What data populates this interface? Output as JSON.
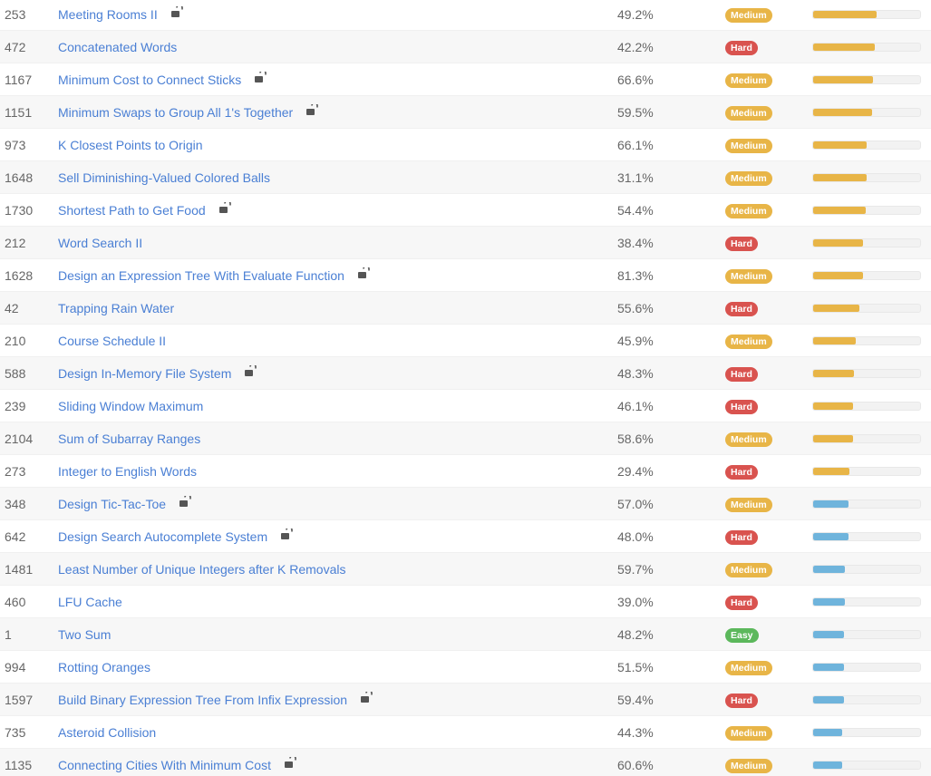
{
  "colors": {
    "medium": "#e8b547",
    "hard": "#d9534f",
    "easy": "#5cb85c",
    "freq_high": "#e8b547",
    "freq_low": "#6fb4dc",
    "link": "#4a7fd4"
  },
  "problems": [
    {
      "id": "253",
      "title": "Meeting Rooms II",
      "locked": true,
      "acceptance": "49.2%",
      "difficulty": "Medium",
      "frequency": 0.59,
      "freq_level": "high"
    },
    {
      "id": "472",
      "title": "Concatenated Words",
      "locked": false,
      "acceptance": "42.2%",
      "difficulty": "Hard",
      "frequency": 0.58,
      "freq_level": "high"
    },
    {
      "id": "1167",
      "title": "Minimum Cost to Connect Sticks",
      "locked": true,
      "acceptance": "66.6%",
      "difficulty": "Medium",
      "frequency": 0.56,
      "freq_level": "high"
    },
    {
      "id": "1151",
      "title": "Minimum Swaps to Group All 1's Together",
      "locked": true,
      "acceptance": "59.5%",
      "difficulty": "Medium",
      "frequency": 0.55,
      "freq_level": "high"
    },
    {
      "id": "973",
      "title": "K Closest Points to Origin",
      "locked": false,
      "acceptance": "66.1%",
      "difficulty": "Medium",
      "frequency": 0.5,
      "freq_level": "high"
    },
    {
      "id": "1648",
      "title": "Sell Diminishing-Valued Colored Balls",
      "locked": false,
      "acceptance": "31.1%",
      "difficulty": "Medium",
      "frequency": 0.5,
      "freq_level": "high"
    },
    {
      "id": "1730",
      "title": "Shortest Path to Get Food",
      "locked": true,
      "acceptance": "54.4%",
      "difficulty": "Medium",
      "frequency": 0.49,
      "freq_level": "high"
    },
    {
      "id": "212",
      "title": "Word Search II",
      "locked": false,
      "acceptance": "38.4%",
      "difficulty": "Hard",
      "frequency": 0.47,
      "freq_level": "high"
    },
    {
      "id": "1628",
      "title": "Design an Expression Tree With Evaluate Function",
      "locked": true,
      "acceptance": "81.3%",
      "difficulty": "Medium",
      "frequency": 0.47,
      "freq_level": "high"
    },
    {
      "id": "42",
      "title": "Trapping Rain Water",
      "locked": false,
      "acceptance": "55.6%",
      "difficulty": "Hard",
      "frequency": 0.43,
      "freq_level": "high"
    },
    {
      "id": "210",
      "title": "Course Schedule II",
      "locked": false,
      "acceptance": "45.9%",
      "difficulty": "Medium",
      "frequency": 0.4,
      "freq_level": "high"
    },
    {
      "id": "588",
      "title": "Design In-Memory File System",
      "locked": true,
      "acceptance": "48.3%",
      "difficulty": "Hard",
      "frequency": 0.38,
      "freq_level": "high"
    },
    {
      "id": "239",
      "title": "Sliding Window Maximum",
      "locked": false,
      "acceptance": "46.1%",
      "difficulty": "Hard",
      "frequency": 0.37,
      "freq_level": "high"
    },
    {
      "id": "2104",
      "title": "Sum of Subarray Ranges",
      "locked": false,
      "acceptance": "58.6%",
      "difficulty": "Medium",
      "frequency": 0.37,
      "freq_level": "high"
    },
    {
      "id": "273",
      "title": "Integer to English Words",
      "locked": false,
      "acceptance": "29.4%",
      "difficulty": "Hard",
      "frequency": 0.34,
      "freq_level": "high"
    },
    {
      "id": "348",
      "title": "Design Tic-Tac-Toe",
      "locked": true,
      "acceptance": "57.0%",
      "difficulty": "Medium",
      "frequency": 0.33,
      "freq_level": "low"
    },
    {
      "id": "642",
      "title": "Design Search Autocomplete System",
      "locked": true,
      "acceptance": "48.0%",
      "difficulty": "Hard",
      "frequency": 0.33,
      "freq_level": "low"
    },
    {
      "id": "1481",
      "title": "Least Number of Unique Integers after K Removals",
      "locked": false,
      "acceptance": "59.7%",
      "difficulty": "Medium",
      "frequency": 0.3,
      "freq_level": "low"
    },
    {
      "id": "460",
      "title": "LFU Cache",
      "locked": false,
      "acceptance": "39.0%",
      "difficulty": "Hard",
      "frequency": 0.3,
      "freq_level": "low"
    },
    {
      "id": "1",
      "title": "Two Sum",
      "locked": false,
      "acceptance": "48.2%",
      "difficulty": "Easy",
      "frequency": 0.29,
      "freq_level": "low"
    },
    {
      "id": "994",
      "title": "Rotting Oranges",
      "locked": false,
      "acceptance": "51.5%",
      "difficulty": "Medium",
      "frequency": 0.29,
      "freq_level": "low"
    },
    {
      "id": "1597",
      "title": "Build Binary Expression Tree From Infix Expression",
      "locked": true,
      "acceptance": "59.4%",
      "difficulty": "Hard",
      "frequency": 0.29,
      "freq_level": "low"
    },
    {
      "id": "735",
      "title": "Asteroid Collision",
      "locked": false,
      "acceptance": "44.3%",
      "difficulty": "Medium",
      "frequency": 0.27,
      "freq_level": "low"
    },
    {
      "id": "1135",
      "title": "Connecting Cities With Minimum Cost",
      "locked": true,
      "acceptance": "60.6%",
      "difficulty": "Medium",
      "frequency": 0.27,
      "freq_level": "low"
    }
  ]
}
